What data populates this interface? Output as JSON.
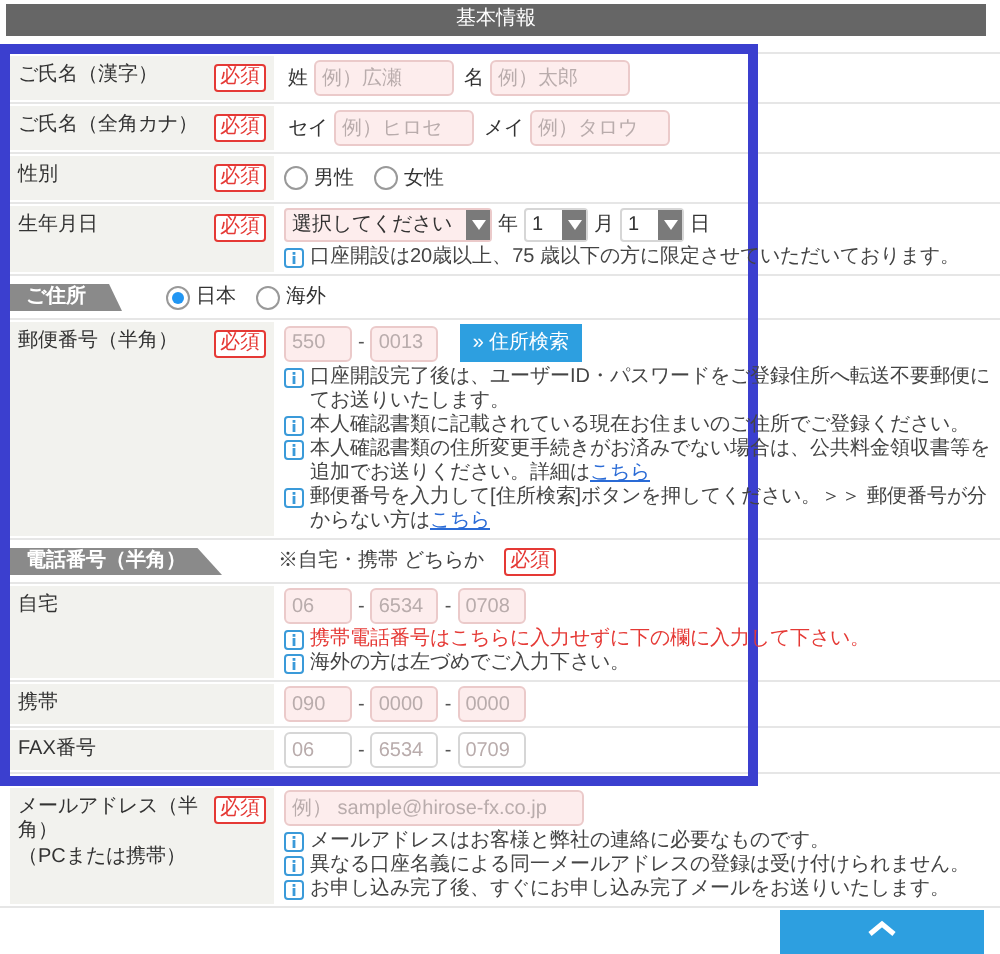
{
  "section_title": "基本情報",
  "rows": [
    {
      "kind": "fields",
      "label": "ご氏名（漢字）",
      "badge": "必須",
      "fields": [
        {
          "prefix": "姓",
          "placeholder": "例）広瀬",
          "tinted": true
        },
        {
          "prefix": "名",
          "placeholder": "例）太郎",
          "tinted": true
        }
      ]
    },
    {
      "kind": "fields",
      "label": "ご氏名（全角カナ）",
      "badge": "必須",
      "fields": [
        {
          "prefix": "セイ",
          "placeholder": "例）ヒロセ",
          "tinted": true
        },
        {
          "prefix": "メイ",
          "placeholder": "例）タロウ",
          "tinted": true
        }
      ]
    },
    {
      "kind": "radios",
      "label": "性別",
      "badge": "必須",
      "options": [
        {
          "label": "男性",
          "selected": false
        },
        {
          "label": "女性",
          "selected": false
        }
      ]
    },
    {
      "kind": "date",
      "label": "生年月日",
      "badge": "必須",
      "selects": [
        {
          "value": "選択してください",
          "unit": "年",
          "tinted": true
        },
        {
          "value": "1",
          "unit": "月",
          "tinted": false
        },
        {
          "value": "1",
          "unit": "日",
          "tinted": false
        }
      ],
      "notes": [
        {
          "text": "口座開設は20歳以上、75 歳以下の方に限定させていただいております。",
          "warning": false
        }
      ]
    },
    {
      "kind": "section",
      "label": "ご住所",
      "options": [
        {
          "label": "日本",
          "selected": true
        },
        {
          "label": "海外",
          "selected": false
        }
      ]
    },
    {
      "kind": "parts",
      "label": "郵便番号（半角）",
      "badge": "必須",
      "separator": "-",
      "parts": [
        {
          "placeholder": "550",
          "tinted": true
        },
        {
          "placeholder": "0013",
          "tinted": true
        }
      ],
      "button": "» 住所検索",
      "notes": [
        {
          "text": "口座開設完了後は、ユーザーID・パスワードをご登録住所へ転送不要郵便にてお送りいたします。",
          "warning": false
        },
        {
          "text": "本人確認書類に記載されている現在お住まいのご住所でご登録ください。",
          "warning": false
        },
        {
          "text": "本人確認書類の住所変更手続きがお済みでない場合は、公共料金領収書等を追加でお送りください。詳細は",
          "link": "こちら",
          "warning": false
        },
        {
          "text": "郵便番号を入力して[住所検索]ボタンを押してください。＞＞ 郵便番号が分からない方は",
          "link": "こちら",
          "warning": false
        }
      ]
    },
    {
      "kind": "section",
      "label": "電話番号（半角）",
      "note": "※自宅・携帯 どちらか",
      "badge": "必須"
    },
    {
      "kind": "parts",
      "label": "自宅",
      "separator": "-",
      "parts": [
        {
          "placeholder": "06",
          "tinted": true
        },
        {
          "placeholder": "6534",
          "tinted": true
        },
        {
          "placeholder": "0708",
          "tinted": true
        }
      ],
      "notes": [
        {
          "text": "携帯電話番号はこちらに入力せずに下の欄に入力して下さい。",
          "warning": true
        },
        {
          "text": "海外の方は左づめでご入力下さい。",
          "warning": false
        }
      ]
    },
    {
      "kind": "parts",
      "label": "携帯",
      "separator": "-",
      "parts": [
        {
          "placeholder": "090",
          "tinted": true
        },
        {
          "placeholder": "0000",
          "tinted": true
        },
        {
          "placeholder": "0000",
          "tinted": true
        }
      ]
    },
    {
      "kind": "parts",
      "label": "FAX番号",
      "separator": "-",
      "parts": [
        {
          "placeholder": "06",
          "tinted": false
        },
        {
          "placeholder": "6534",
          "tinted": false
        },
        {
          "placeholder": "0709",
          "tinted": false
        }
      ]
    },
    {
      "kind": "email",
      "label": "メールアドレス（半角）",
      "sublabel": "（PCまたは携帯）",
      "badge": "必須",
      "placeholder": "例） sample@hirose-fx.co.jp",
      "tinted": true,
      "notes": [
        {
          "text": "メールアドレスはお客様と弊社の連絡に必要なものです。",
          "warning": false
        },
        {
          "text": "異なる口座名義による同一メールアドレスの登録は受け付けられません。",
          "warning": false
        },
        {
          "text": "お申し込み完了後、すぐにお申し込み完了メールをお送りいたします。",
          "warning": false
        }
      ]
    }
  ]
}
